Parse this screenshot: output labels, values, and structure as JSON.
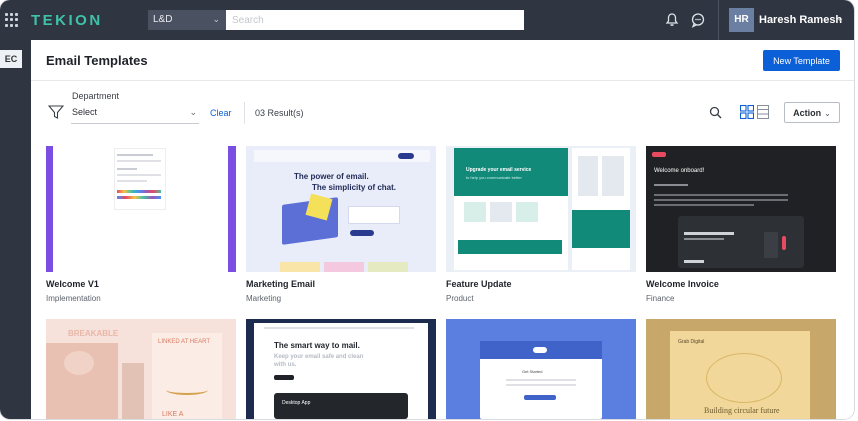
{
  "topbar": {
    "logo": "TEKION",
    "scope_label": "L&D",
    "search_placeholder": "Search",
    "user_initials": "HR",
    "user_name": "Haresh Ramesh"
  },
  "rail": {
    "app_badge": "EC"
  },
  "header": {
    "title": "Email Templates",
    "new_button": "New Template"
  },
  "filters": {
    "label": "Department",
    "select_value": "Select",
    "clear_label": "Clear",
    "results_text": "03 Result(s)",
    "action_label": "Action"
  },
  "templates": [
    {
      "name": "Welcome V1",
      "category": "Implementation"
    },
    {
      "name": "Marketing Email",
      "category": "Marketing",
      "preview_lines": [
        "The power of email.",
        "The simplicity of chat."
      ]
    },
    {
      "name": "Feature Update",
      "category": "Product",
      "preview_lines": [
        "Upgrade your email service",
        "to help you communicate better"
      ]
    },
    {
      "name": "Welcome Invoice",
      "category": "Finance",
      "preview_lines": [
        "Welcome onboard!"
      ]
    }
  ],
  "row2_previews": [
    {
      "text_a": "BREAKABLE",
      "text_b": "LINKED AT HEART",
      "text_c": "LIKE A"
    },
    {
      "text_a": "The smart way to mail.",
      "text_b": "Keep your email safe and clean with us.",
      "text_c": "Desktop App"
    },
    {
      "text_a": "Get Started"
    },
    {
      "text_a": "Grab Digital",
      "text_b": "Building circular future"
    }
  ],
  "colors": {
    "topbar": "#2f3541",
    "accent": "#0b5fd7",
    "logo": "#3fc3a8"
  }
}
